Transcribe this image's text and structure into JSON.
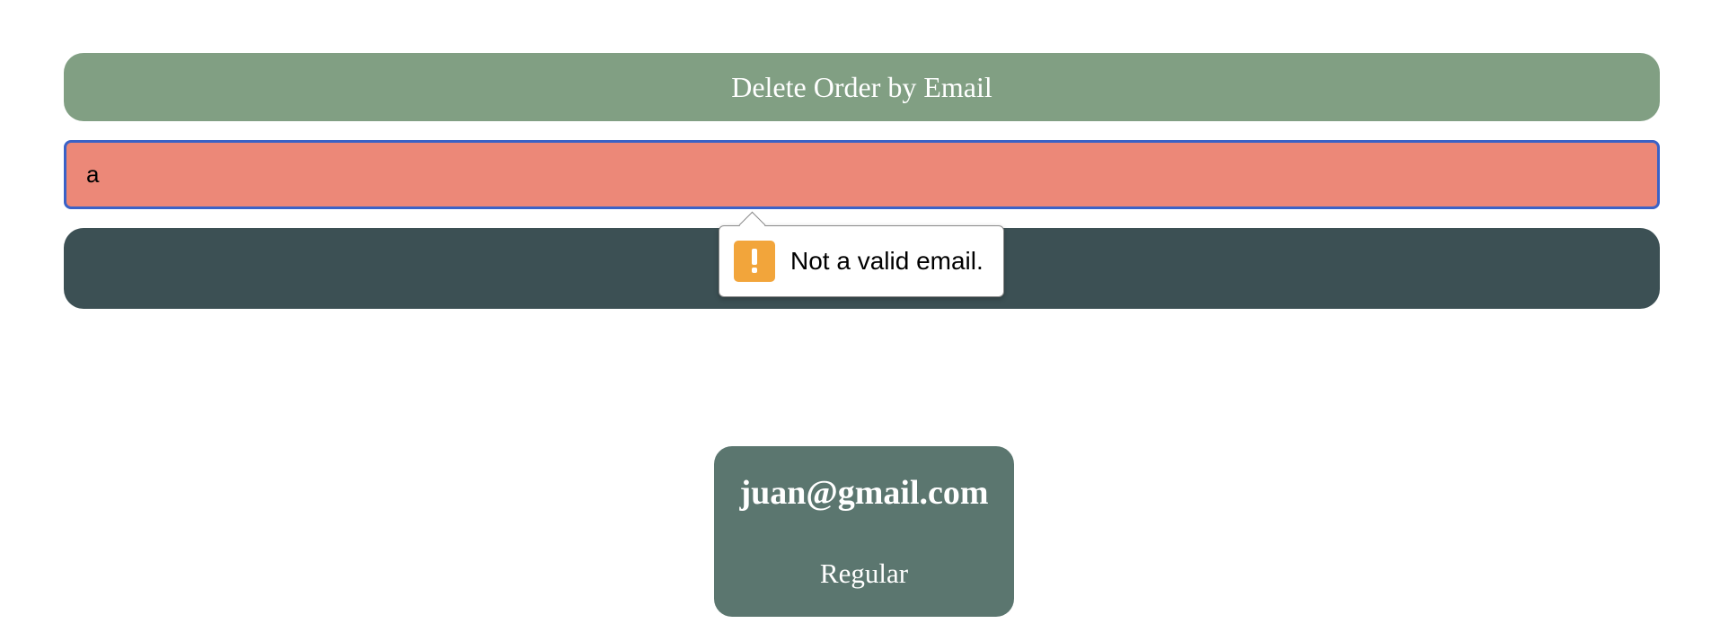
{
  "header": {
    "title": "Delete Order by Email"
  },
  "form": {
    "email_value": "a",
    "submit_label": ""
  },
  "validation": {
    "message": "Not a valid email.",
    "icon": "warning-icon",
    "icon_color": "#f2a53b"
  },
  "orders": [
    {
      "email": "juan@gmail.com",
      "type": "Regular"
    }
  ],
  "colors": {
    "header_bg": "#819f83",
    "input_invalid_bg": "#ec8878",
    "focus_border": "#3a62c7",
    "button_bg": "#3c5054",
    "card_bg": "#5b766f"
  }
}
